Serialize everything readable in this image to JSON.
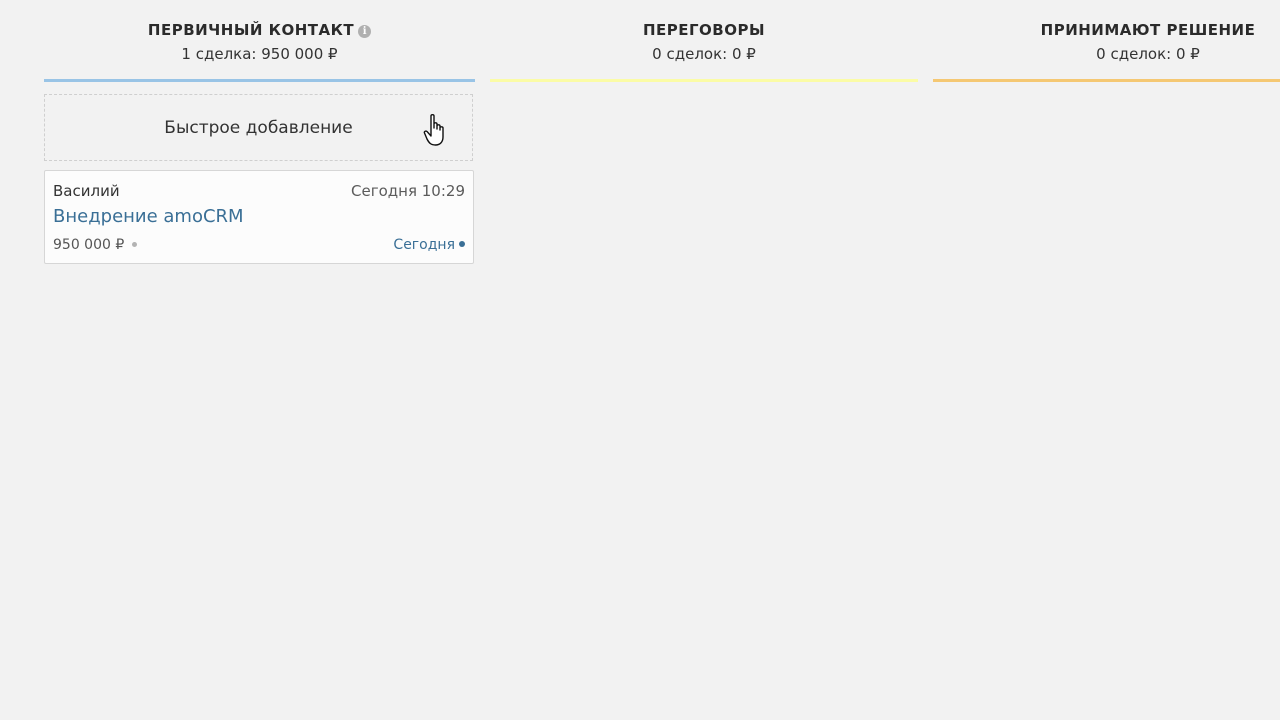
{
  "columns": [
    {
      "title": "ПЕРВИЧНЫЙ КОНТАКТ",
      "summary": "1 сделка: 950 000 ₽",
      "bar_color": "#99c4e6",
      "info_icon": "i"
    },
    {
      "title": "ПЕРЕГОВОРЫ",
      "summary": "0 сделок: 0 ₽",
      "bar_color": "#fbfca6"
    },
    {
      "title": "ПРИНИМАЮТ РЕШЕНИЕ",
      "summary": "0 сделок: 0 ₽",
      "bar_color": "#f5c873"
    }
  ],
  "quick_add": {
    "label": "Быстрое добавление",
    "cursor_icon": "hand-pointer-icon"
  },
  "deal": {
    "contact": "Василий",
    "date": "Сегодня 10:29",
    "title": "Внедрение amoCRM",
    "price": "950 000 ₽",
    "task": "Сегодня",
    "link_color": "#3a6f96"
  }
}
